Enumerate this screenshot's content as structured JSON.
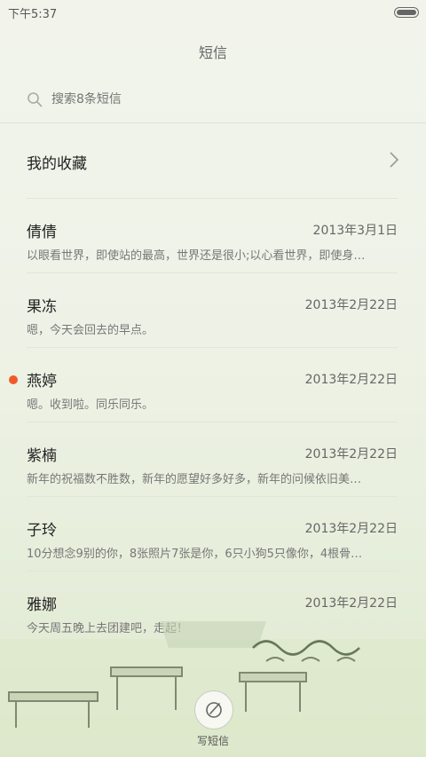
{
  "status_bar": {
    "time": "下午5:37"
  },
  "header": {
    "title": "短信"
  },
  "search": {
    "placeholder": "搜索8条短信"
  },
  "favorites": {
    "label": "我的收藏"
  },
  "messages": [
    {
      "name": "倩倩",
      "date": "2013年3月1日",
      "preview": "以眼看世界，即使站的最高，世界还是很小;以心看世界，即使身…"
    },
    {
      "name": "果冻",
      "date": "2013年2月22日",
      "preview": "嗯，今天会回去的早点。"
    },
    {
      "name": "燕婷",
      "date": "2013年2月22日",
      "preview": "嗯。收到啦。同乐同乐。",
      "unread": true
    },
    {
      "name": "紫楠",
      "date": "2013年2月22日",
      "preview": "新年的祝福数不胜数，新年的愿望好多好多，新年的问候依旧美…"
    },
    {
      "name": "子玲",
      "date": "2013年2月22日",
      "preview": "10分想念9别的你，8张照片7张是你，6只小狗5只像你，4根骨…"
    },
    {
      "name": "雅娜",
      "date": "2013年2月22日",
      "preview": "今天周五晚上去团建吧，走起！"
    }
  ],
  "compose": {
    "label": "写短信"
  },
  "colors": {
    "unread_dot": "#f05a28",
    "background": "#eef2e6"
  }
}
